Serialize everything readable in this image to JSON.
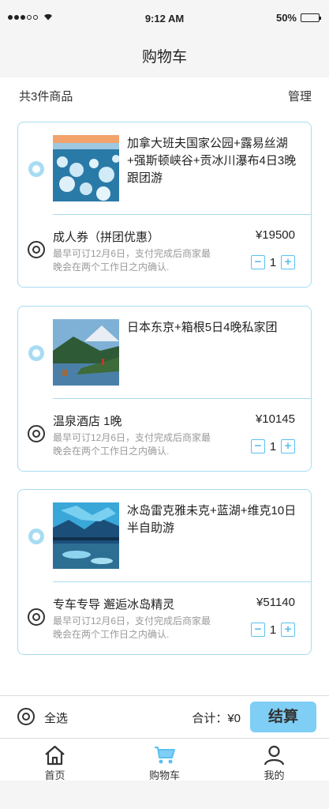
{
  "status_bar": {
    "time": "9:12 AM",
    "battery": "50%",
    "battery_level": 0.5
  },
  "nav": {
    "title": "购物车"
  },
  "summary": {
    "count": "共3件商品",
    "manage": "管理"
  },
  "cards": [
    {
      "title": "加拿大班夫国家公园+露易丝湖+强斯顿峡谷+贡冰川瀑布4日3晚跟团游",
      "item": "成人券（拼团优惠）",
      "note": "最早可订12月6日，支付完成后商家最晚会在两个工作日之内确认.",
      "price": "¥19500",
      "qty": "1"
    },
    {
      "title": "日本东京+箱根5日4晚私家团",
      "item": "温泉酒店 1晚",
      "note": "最早可订12月6日，支付完成后商家最晚会在两个工作日之内确认.",
      "price": "¥10145",
      "qty": "1"
    },
    {
      "title": "冰岛雷克雅未克+蓝湖+维克10日半自助游",
      "item": "专车专导  邂逅冰岛精灵",
      "note": "最早可订12月6日，支付完成后商家最晚会在两个工作日之内确认.",
      "price": "¥51140",
      "qty": "1"
    }
  ],
  "stepper": {
    "minus": "−",
    "plus": "+"
  },
  "footer": {
    "select_all": "全选",
    "total": "合计：¥0",
    "checkout": "结算"
  },
  "tabs": [
    {
      "label": "首页",
      "icon": "home-icon"
    },
    {
      "label": "购物车",
      "icon": "cart-icon",
      "active": true
    },
    {
      "label": "我的",
      "icon": "user-icon"
    }
  ],
  "colors": {
    "accent": "#7fcef5",
    "border": "#a7dcf3",
    "icon_blue": "#5bc0ee"
  }
}
